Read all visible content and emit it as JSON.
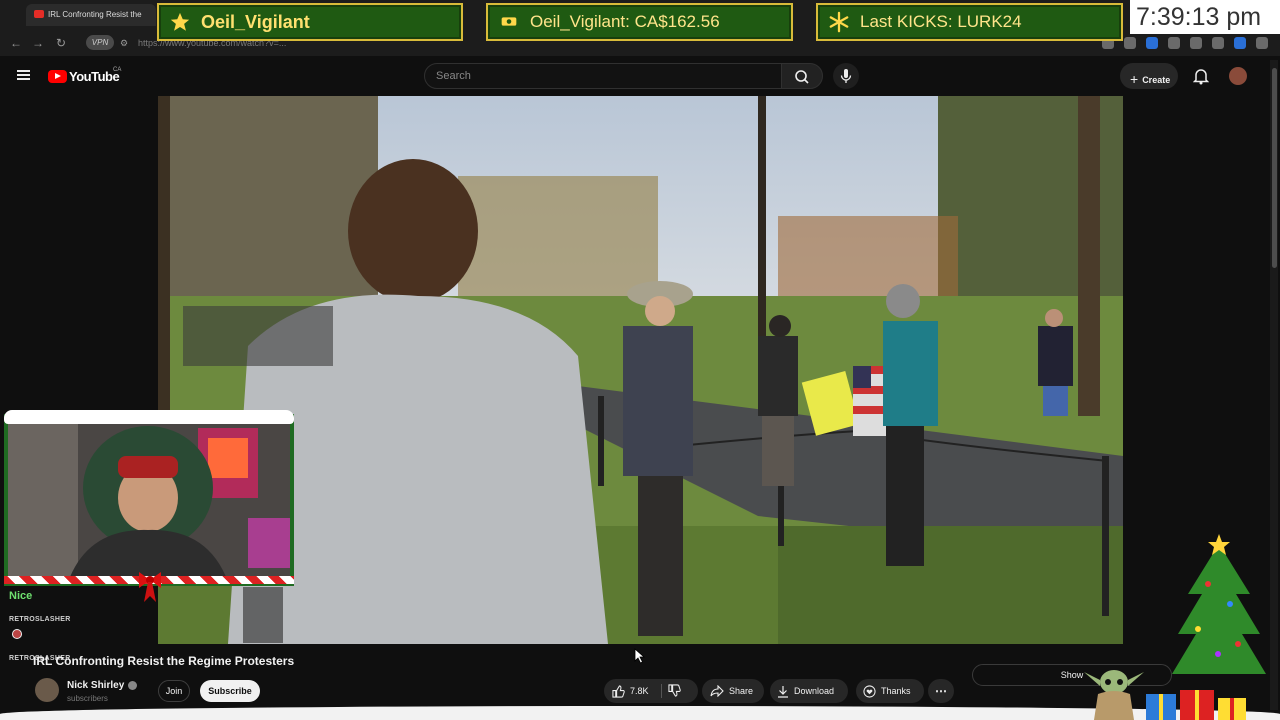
{
  "browser": {
    "tab_title": "IRL Confronting Resist the",
    "url": "https://www.youtube.com/watch?v=..."
  },
  "overlay": {
    "banners": [
      {
        "text": "Oeil_Vigilant",
        "icon": "star-icon"
      },
      {
        "text": "Oeil_Vigilant: CA$162.56",
        "icon": "money-hand-icon"
      },
      {
        "text": "Last KICKS: LURK24",
        "icon": "snowflake-icon"
      }
    ],
    "clock": "7:39:13 pm"
  },
  "youtube": {
    "logo_text": "YouTube",
    "country": "CA",
    "search_placeholder": "Search",
    "create_label": "Create"
  },
  "chat": {
    "message": "Nice",
    "users": [
      "RETROSLASHER",
      "RETROSLASHER"
    ]
  },
  "video": {
    "title": "IRL Confronting Resist the Regime Protesters",
    "channel": "Nick Shirley",
    "subscribers": "subscribers",
    "join_label": "Join",
    "subscribe_label": "Subscribe",
    "likes": "7.8K",
    "share_label": "Share",
    "download_label": "Download",
    "thanks_label": "Thanks",
    "show_label": "Show"
  },
  "colors": {
    "banner_bg": "#1f5a12",
    "banner_border": "#d8bb3a",
    "banner_text": "#ffe070",
    "yt_red": "#ff0000"
  }
}
